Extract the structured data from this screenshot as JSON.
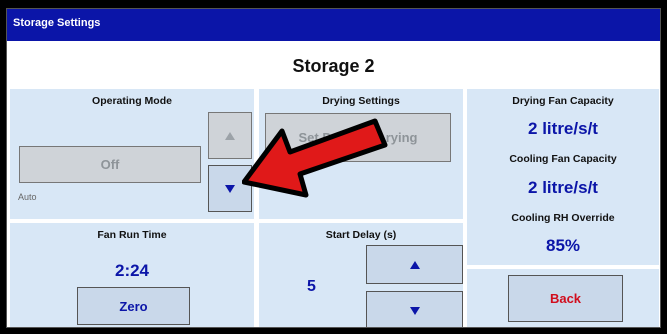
{
  "window": {
    "title": "Storage Settings"
  },
  "header": {
    "storage_name": "Storage 2"
  },
  "operating_mode": {
    "title": "Operating Mode",
    "toggle_label": "Off",
    "mode_text": "Auto"
  },
  "fan_run_time": {
    "title": "Fan Run Time",
    "value": "2:24",
    "zero_label": "Zero"
  },
  "drying_settings": {
    "title": "Drying Settings",
    "button_label_left": "Set D",
    "button_label_right": "rying"
  },
  "start_delay": {
    "title": "Start Delay (s)",
    "value": "5"
  },
  "capacities": {
    "drying_title": "Drying Fan Capacity",
    "drying_value": "2 litre/s/t",
    "cooling_title": "Cooling Fan Capacity",
    "cooling_value": "2 litre/s/t",
    "rh_title": "Cooling RH Override",
    "rh_value": "85%"
  },
  "footer": {
    "back_label": "Back"
  },
  "icons": {
    "up": "arrow-up-icon",
    "down": "arrow-down-icon",
    "callout": "red-arrow-callout-icon"
  },
  "colors": {
    "titlebar": "#0b15a8",
    "panel": "#d8e7f6",
    "value_blue": "#0b15a8",
    "back_red": "#d10d1d",
    "callout_red": "#e01919"
  }
}
